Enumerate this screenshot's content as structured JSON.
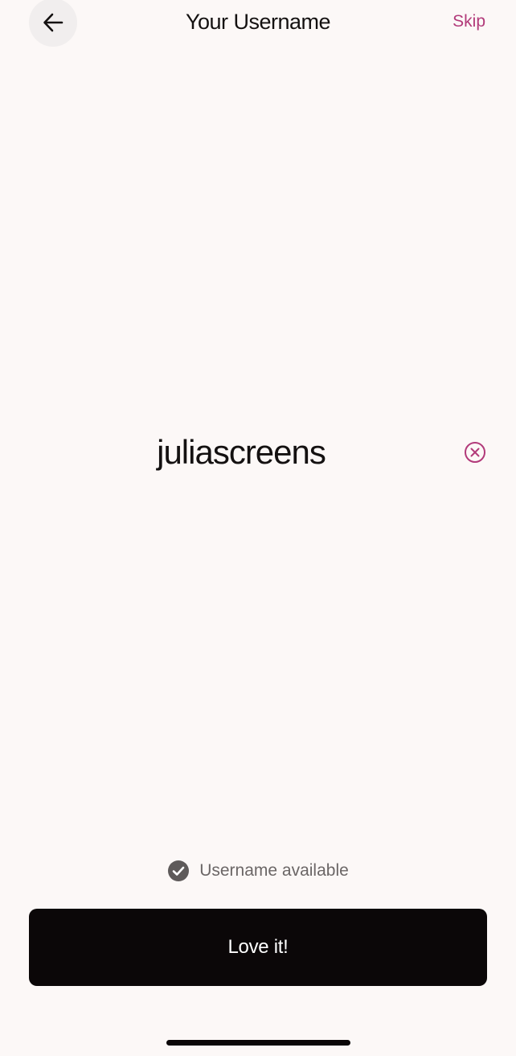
{
  "header": {
    "title": "Your Username",
    "skip_label": "Skip",
    "back_icon": "arrow-left-icon"
  },
  "username": {
    "value": "juliascreens",
    "clear_icon": "clear-circle-x-icon"
  },
  "availability": {
    "icon": "check-circle-icon",
    "text": "Username available"
  },
  "primary_button": {
    "label": "Love it!"
  },
  "colors": {
    "background": "#fcf8f7",
    "accent": "#b23a7a",
    "button": "#0b0708",
    "muted_text": "#6b6666"
  }
}
